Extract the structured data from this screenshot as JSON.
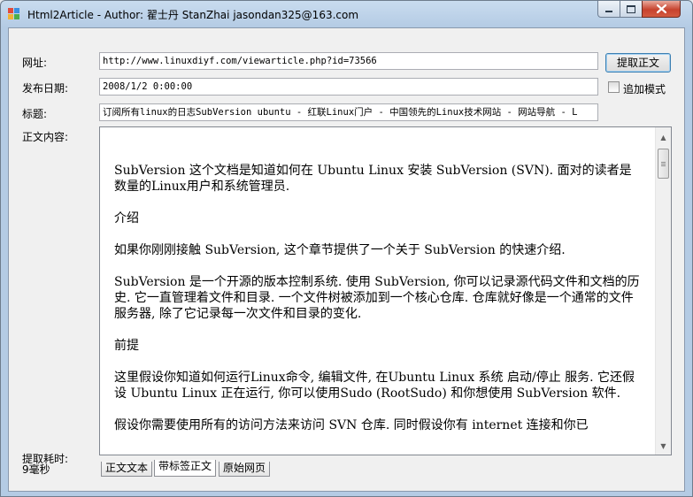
{
  "window": {
    "title": "Html2Article - Author: 翟士丹 StanZhai jasondan325@163.com"
  },
  "form": {
    "url_label": "网址:",
    "url_value": "http://www.linuxdiyf.com/viewarticle.php?id=73566",
    "extract_button": "提取正文",
    "date_label": "发布日期:",
    "date_value": "2008/1/2 0:00:00",
    "append_mode_label": "追加模式",
    "append_mode_checked": false,
    "title_label": "标题:",
    "title_value": "订阅所有linux的日志SubVersion ubuntu - 红联Linux门户 - 中国领先的Linux技术网站 - 网站导航 - L",
    "content_label": "正文内容:",
    "elapsed_label": "提取耗时:",
    "elapsed_value": "9毫秒"
  },
  "content": {
    "paragraphs": [
      "SubVersion 这个文档是知道如何在  Ubuntu Linux 安装  SubVersion (SVN). 面对的读者是数量的Linux用户和系统管理员.",
      "介绍",
      "如果你刚刚接触  SubVersion, 这个章节提供了一个关于  SubVersion 的快速介绍.",
      "SubVersion 是一个开源的版本控制系统. 使用  SubVersion, 你可以记录源代码文件和文档的历史. 它一直管理着文件和目录. 一个文件树被添加到一个核心仓库. 仓库就好像是一个通常的文件服务器, 除了它记录每一次文件和目录的变化.",
      "前提",
      "这里假设你知道如何运行Linux命令, 编辑文件, 在Ubuntu Linux 系统  启动/停止  服务. 它还假设  Ubuntu Linux 正在运行, 你可以使用Sudo (RootSudo) 和你想使用  SubVersion 软件.",
      "假设你需要使用所有的访问方法来访问  SVN 仓库. 同时假设你有  internet 连接和你已"
    ],
    "scroll_position": 0
  },
  "tabs": [
    {
      "label": "正文文本",
      "active": false
    },
    {
      "label": "带标签正文",
      "active": true
    },
    {
      "label": "原始网页",
      "active": false
    }
  ],
  "colors": {
    "titlebar": "#b4cbe4",
    "client_bg": "#f0f0f0",
    "close_button": "#c7432e"
  }
}
